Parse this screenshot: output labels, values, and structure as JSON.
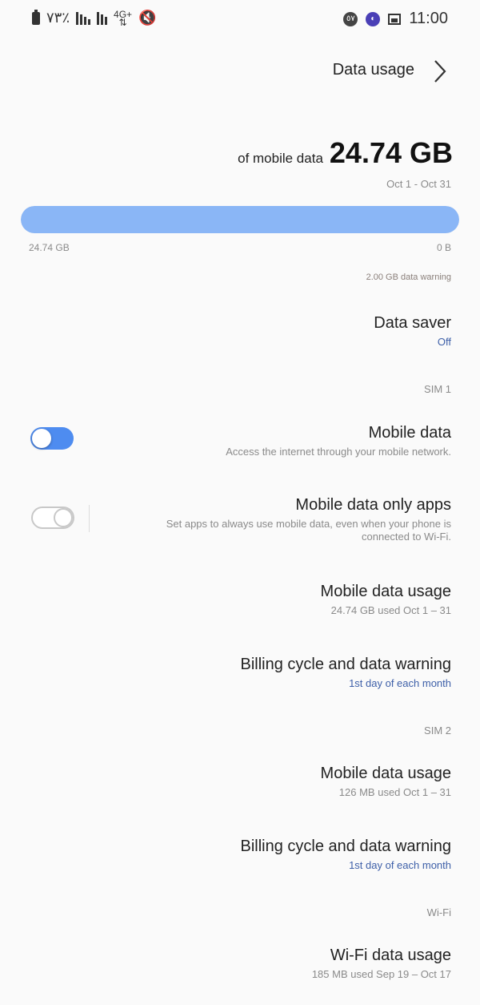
{
  "status_bar": {
    "battery": "٧٣٪",
    "network": "4G+",
    "time": "11:00",
    "notification_badge": "٥٧",
    "icons": [
      "battery-icon",
      "signal-icon",
      "signal-icon",
      "network-icon",
      "mute-icon",
      "notification-icon",
      "app-icon",
      "image-icon"
    ]
  },
  "header": {
    "title": "Data usage",
    "back_icon": "chevron-icon"
  },
  "summary": {
    "amount": "24.74 GB",
    "suffix": "of mobile data",
    "period": "Oct 1 - Oct 31",
    "bar_fill_fraction": 1.0,
    "bar_color": "#8ab6f6",
    "scale_start": "0 B",
    "scale_end": "24.74 GB",
    "warning": "2.00 GB data warning"
  },
  "data_saver": {
    "title": "Data saver",
    "value": "Off"
  },
  "sim1": {
    "label": "SIM 1",
    "mobile_data": {
      "title": "Mobile data",
      "subtitle": "Access the internet through your mobile network.",
      "enabled": true
    },
    "mobile_data_only_apps": {
      "title": "Mobile data only apps",
      "subtitle_line1": "Set apps to always use mobile data, even when your phone is",
      "subtitle_line2": "connected to Wi-Fi.",
      "enabled": false
    },
    "usage": {
      "title": "Mobile data usage",
      "subtitle": "24.74 GB used Oct 1 – 31"
    },
    "billing": {
      "title": "Billing cycle and data warning",
      "subtitle": "1st day of each month"
    }
  },
  "sim2": {
    "label": "SIM 2",
    "usage": {
      "title": "Mobile data usage",
      "subtitle": "126 MB used Oct 1 – 31"
    },
    "billing": {
      "title": "Billing cycle and data warning",
      "subtitle": "1st day of each month"
    }
  },
  "wifi": {
    "label": "Wi-Fi",
    "usage": {
      "title": "Wi-Fi data usage",
      "subtitle": "185 MB used Sep 19 – Oct 17"
    }
  },
  "colors": {
    "toggle_on": "#4e8cf0",
    "accent_text": "#3d5fa8",
    "background": "#fafafa"
  }
}
